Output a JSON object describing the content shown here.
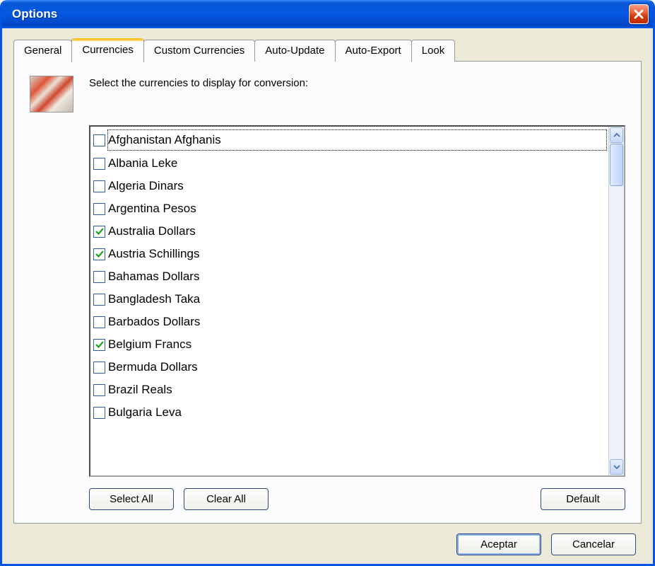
{
  "window": {
    "title": "Options"
  },
  "tabs": [
    {
      "label": "General",
      "active": false
    },
    {
      "label": "Currencies",
      "active": true
    },
    {
      "label": "Custom Currencies",
      "active": false
    },
    {
      "label": "Auto-Update",
      "active": false
    },
    {
      "label": "Auto-Export",
      "active": false
    },
    {
      "label": "Look",
      "active": false
    }
  ],
  "instruction": "Select the currencies to display for conversion:",
  "currencies": [
    {
      "label": "Afghanistan Afghanis",
      "checked": false,
      "focused": true
    },
    {
      "label": "Albania Leke",
      "checked": false
    },
    {
      "label": "Algeria Dinars",
      "checked": false
    },
    {
      "label": "Argentina Pesos",
      "checked": false
    },
    {
      "label": "Australia Dollars",
      "checked": true
    },
    {
      "label": "Austria Schillings",
      "checked": true
    },
    {
      "label": "Bahamas Dollars",
      "checked": false
    },
    {
      "label": "Bangladesh Taka",
      "checked": false
    },
    {
      "label": "Barbados Dollars",
      "checked": false
    },
    {
      "label": "Belgium Francs",
      "checked": true
    },
    {
      "label": "Bermuda Dollars",
      "checked": false
    },
    {
      "label": "Brazil Reals",
      "checked": false
    },
    {
      "label": "Bulgaria Leva",
      "checked": false
    }
  ],
  "buttons": {
    "select_all": "Select All",
    "clear_all": "Clear All",
    "default": "Default",
    "accept": "Aceptar",
    "cancel": "Cancelar"
  }
}
